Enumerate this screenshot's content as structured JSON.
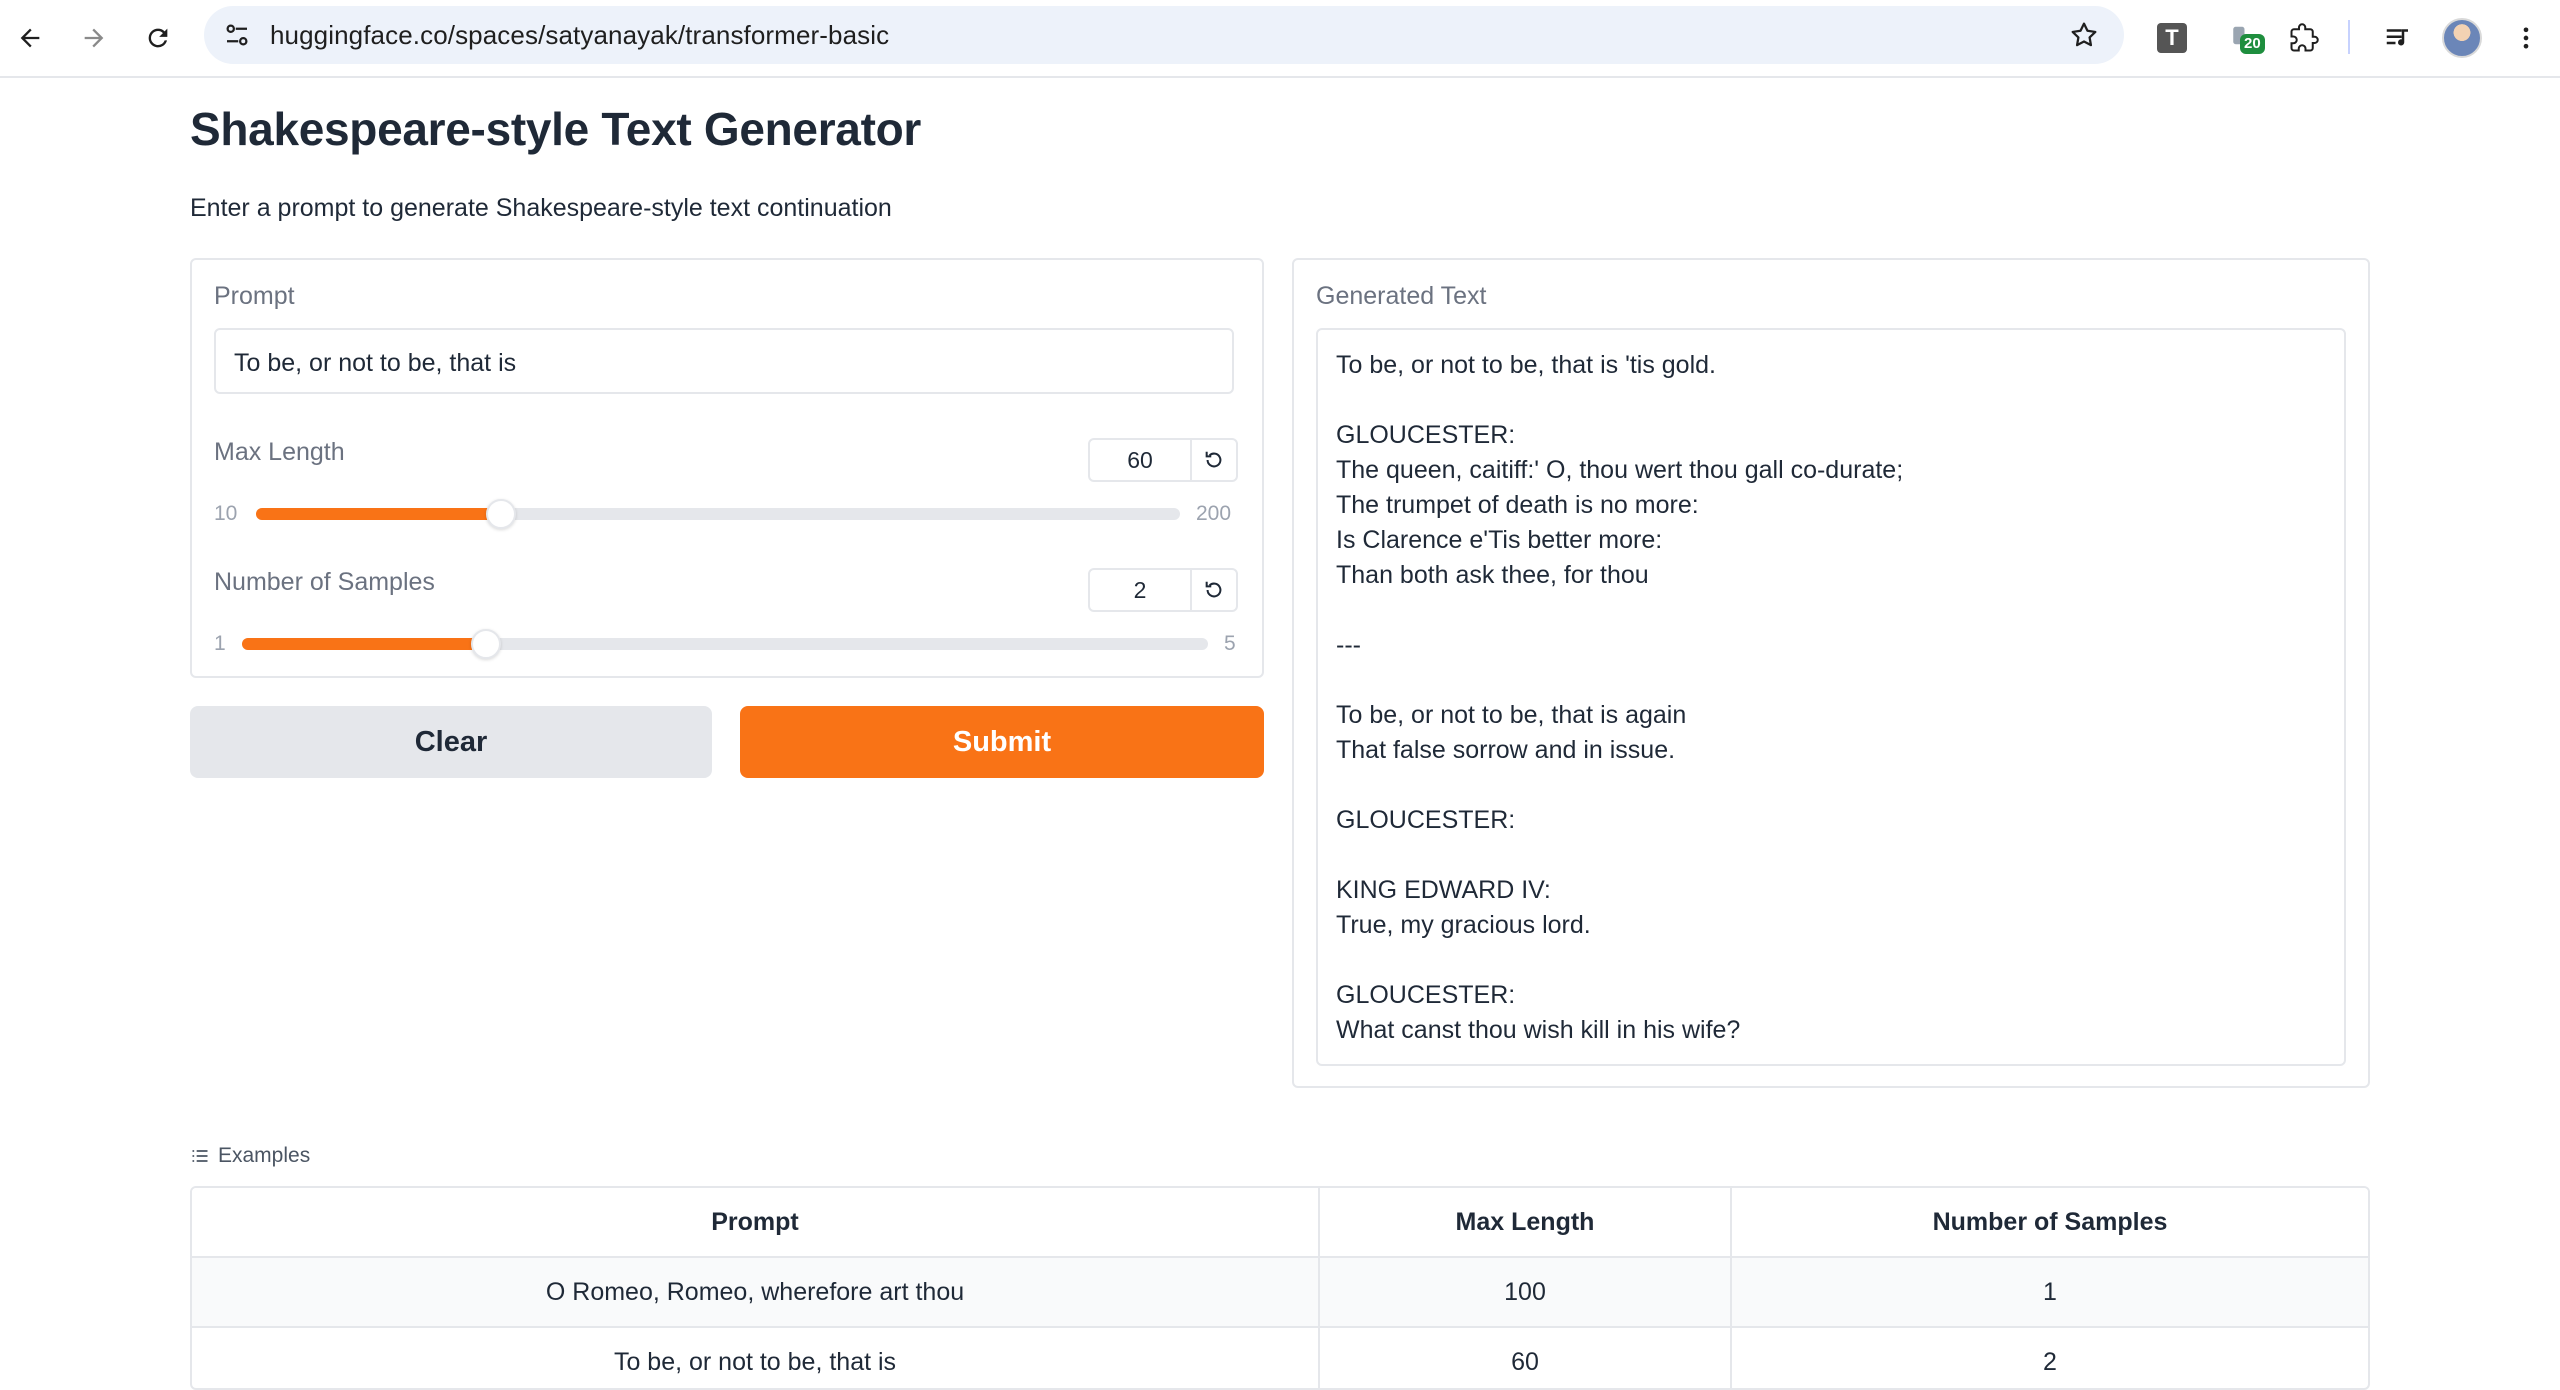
{
  "browser": {
    "url": "huggingface.co/spaces/satyanayak/transformer-basic",
    "extensions_badge": "20",
    "t_extension_letter": "T"
  },
  "app": {
    "title": "Shakespeare-style Text Generator",
    "description": "Enter a prompt to generate Shakespeare-style text continuation"
  },
  "inputs": {
    "prompt_label": "Prompt",
    "prompt_value": "To be, or not to be, that is",
    "max_length": {
      "label": "Max Length",
      "value": "60",
      "min": "10",
      "max": "200",
      "fraction": 0.263
    },
    "num_samples": {
      "label": "Number of Samples",
      "value": "2",
      "min": "1",
      "max": "5",
      "fraction": 0.25
    }
  },
  "buttons": {
    "clear": "Clear",
    "submit": "Submit"
  },
  "output": {
    "label": "Generated Text",
    "text": "To be, or not to be, that is 'tis gold.\n\nGLOUCESTER:\nThe queen, caitiff:' O, thou wert thou gall co-durate;\nThe trumpet of death is no more:\nIs Clarence e'Tis better more:\nThan both ask thee, for thou\n\n---\n\nTo be, or not to be, that is again\nThat false sorrow and in issue.\n\nGLOUCESTER:\n\nKING EDWARD IV:\nTrue, my gracious lord.\n\nGLOUCESTER:\nWhat canst thou wish kill in his wife?"
  },
  "examples": {
    "label": "Examples",
    "headers": [
      "Prompt",
      "Max Length",
      "Number of Samples"
    ],
    "rows": [
      [
        "O Romeo, Romeo, wherefore art thou",
        "100",
        "1"
      ],
      [
        "To be, or not to be, that is",
        "60",
        "2"
      ]
    ]
  },
  "colors": {
    "accent": "#f97316",
    "clear_button": "#e5e7eb",
    "omnibox": "#edf2fa",
    "badge": "#1e8e3e"
  },
  "icons": [
    "back-arrow-icon",
    "forward-arrow-icon",
    "reload-icon",
    "site-settings-icon",
    "bookmark-star-icon",
    "extension-t-icon",
    "extension-badge-icon",
    "puzzle-extensions-icon",
    "media-controls-icon",
    "profile-avatar",
    "more-menu-icon",
    "reset-icon",
    "list-icon"
  ]
}
